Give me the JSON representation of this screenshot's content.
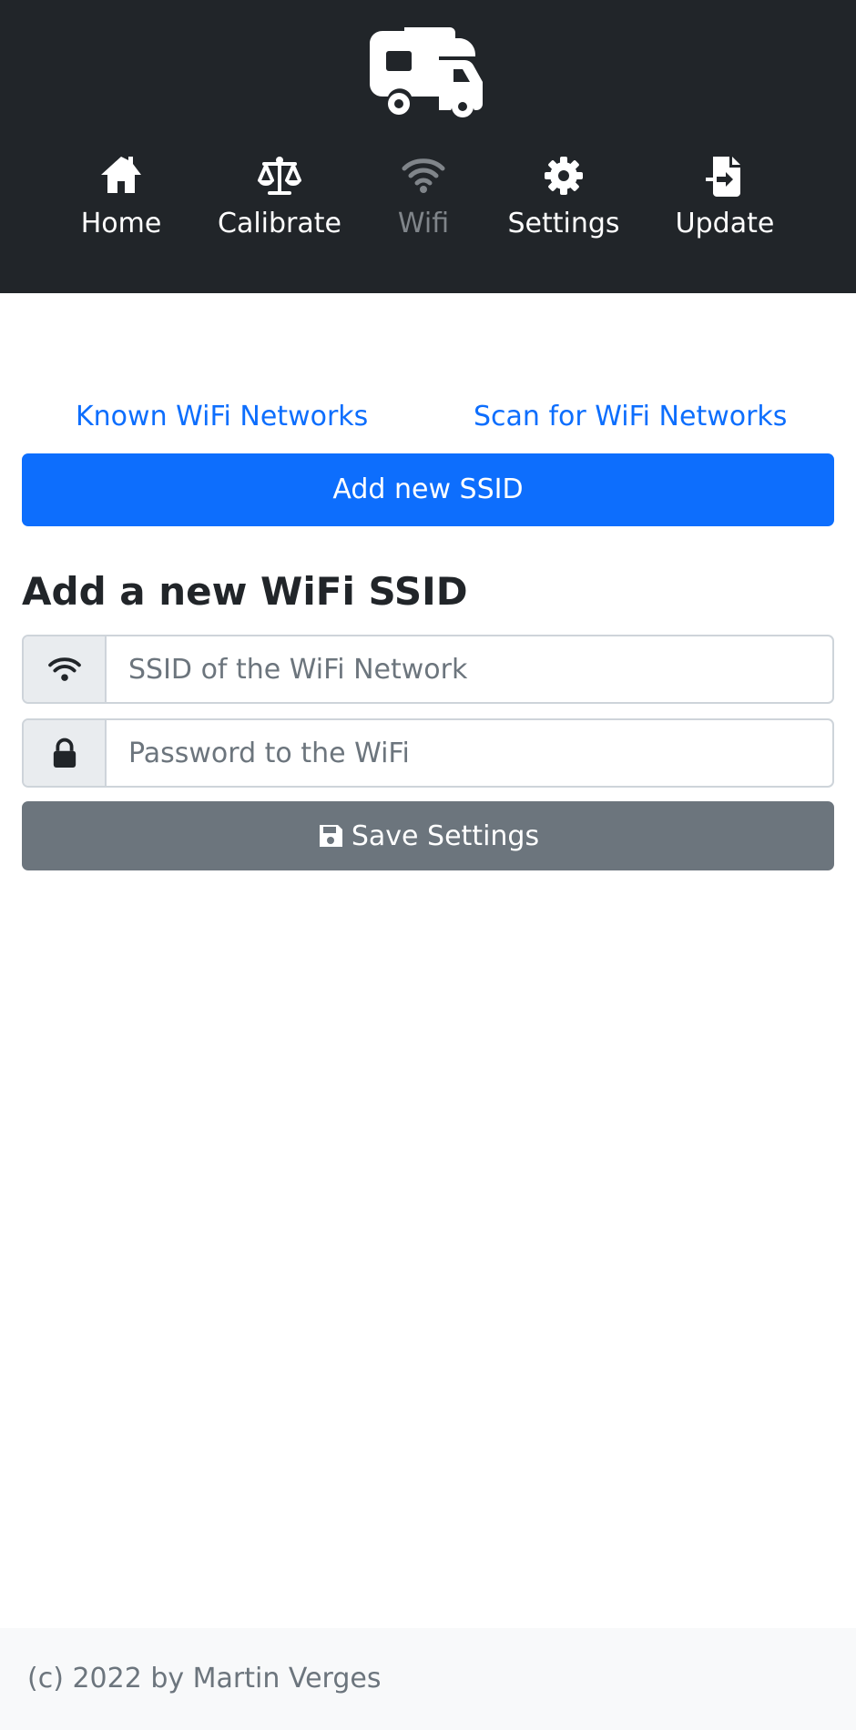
{
  "header": {
    "logo_icon": "caravan-icon",
    "nav": [
      {
        "label": "Home",
        "icon": "home-icon",
        "active": false
      },
      {
        "label": "Calibrate",
        "icon": "scale-balance-icon",
        "active": false
      },
      {
        "label": "Wifi",
        "icon": "wifi-icon",
        "active": true
      },
      {
        "label": "Settings",
        "icon": "gear-icon",
        "active": false
      },
      {
        "label": "Update",
        "icon": "file-import-icon",
        "active": false
      }
    ]
  },
  "main": {
    "tabs": [
      {
        "label": "Known WiFi Networks"
      },
      {
        "label": "Scan for WiFi Networks"
      }
    ],
    "add_button_label": "Add new SSID",
    "form": {
      "title": "Add a new WiFi SSID",
      "ssid": {
        "placeholder": "SSID of the WiFi Network",
        "value": "",
        "icon": "wifi-icon"
      },
      "password": {
        "placeholder": "Password to the WiFi",
        "value": "",
        "icon": "lock-icon"
      },
      "save_label": "Save Settings",
      "save_icon": "floppy-disk-icon"
    }
  },
  "footer": {
    "text": "(c) 2022 by Martin Verges"
  },
  "colors": {
    "header_bg": "#212529",
    "primary": "#0d6efd",
    "secondary": "#6c757d",
    "nav_disabled": "#80858a",
    "footer_bg": "#f8f9fa"
  }
}
